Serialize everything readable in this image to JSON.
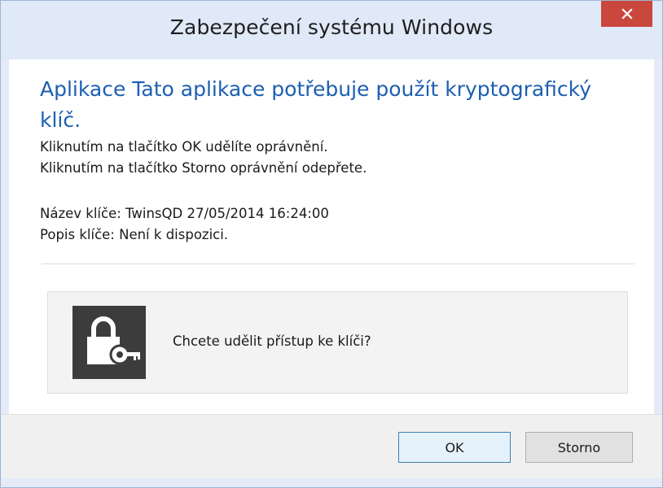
{
  "window": {
    "title": "Zabezpečení systému Windows",
    "accent": "#1c5fb2",
    "close_button_color": "#c9473c"
  },
  "content": {
    "main_instruction": "Aplikace Tato aplikace potřebuje použít kryptografický klíč.",
    "lines": [
      "Kliknutím na tlačítko OK udělíte oprávnění.",
      "Kliknutím na tlačítko Storno oprávnění odepřete."
    ],
    "key_name": "Název klíče: TwinsQD 27/05/2014 16:24:00",
    "key_description": "Popis klíče: Není k dispozici."
  },
  "prompt": {
    "icon": "lock-key-icon",
    "question": "Chcete udělit přístup ke klíči?"
  },
  "buttons": {
    "ok": "OK",
    "cancel": "Storno"
  }
}
